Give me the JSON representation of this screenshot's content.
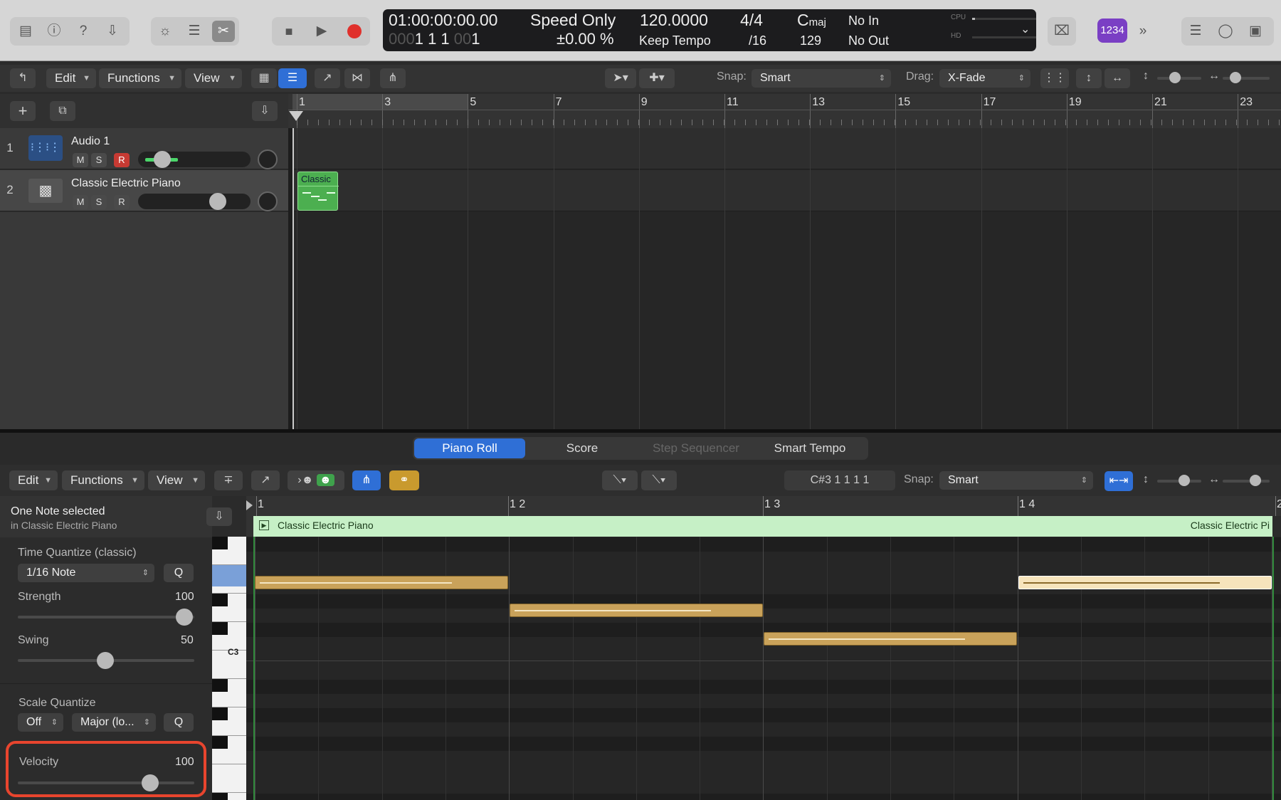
{
  "control_bar": {
    "lcd": {
      "timecode": "01:00:00:00.00",
      "bars_dim": "000",
      "bars_bright": "1  1  1",
      "ticks_dim": "00",
      "ticks_bright": "1",
      "speed_mode": "Speed Only",
      "speed_pct": "±0.00 %",
      "tempo": "120.0000",
      "tempo_mode": "Keep Tempo",
      "time_sig": "4/4",
      "division": "/16",
      "key_root": "C",
      "key_mode": "maj",
      "key_value": "129",
      "midi_in": "No In",
      "midi_out": "No Out",
      "cpu_label": "CPU",
      "hd_label": "HD"
    },
    "counter_badge": "1234"
  },
  "tracks_toolbar": {
    "edit": "Edit",
    "functions": "Functions",
    "view": "View",
    "snap_label": "Snap:",
    "snap_value": "Smart",
    "drag_label": "Drag:",
    "drag_value": "X-Fade"
  },
  "ruler": {
    "bars": [
      "1",
      "3",
      "5",
      "7",
      "9",
      "11",
      "13",
      "15",
      "17",
      "19",
      "21",
      "23"
    ]
  },
  "tracks": [
    {
      "number": "1",
      "name": "Audio 1",
      "m": "M",
      "s": "S",
      "r": "R"
    },
    {
      "number": "2",
      "name": "Classic Electric Piano",
      "m": "M",
      "s": "S",
      "r": "R"
    }
  ],
  "region": {
    "label": "Classic"
  },
  "editor_tabs": {
    "piano_roll": "Piano Roll",
    "score": "Score",
    "step_sequencer": "Step Sequencer",
    "smart_tempo": "Smart Tempo"
  },
  "piano_toolbar": {
    "edit": "Edit",
    "functions": "Functions",
    "view": "View",
    "position": "C#3  1 1 1 1",
    "snap_label": "Snap:",
    "snap_value": "Smart"
  },
  "inspector": {
    "selection_title": "One Note selected",
    "selection_sub": "in Classic Electric Piano",
    "time_quantize_label": "Time Quantize (classic)",
    "time_quantize_value": "1/16 Note",
    "q": "Q",
    "strength_label": "Strength",
    "strength_value": "100",
    "swing_label": "Swing",
    "swing_value": "50",
    "scale_quantize_label": "Scale Quantize",
    "scale_off": "Off",
    "scale_mode": "Major (lo...",
    "velocity_label": "Velocity",
    "velocity_value": "100"
  },
  "piano_roll": {
    "bars": [
      "1",
      "1 2",
      "1 3",
      "1 4",
      "2"
    ],
    "region_name_left": "Classic Electric Piano",
    "region_name_right": "Classic Electric Pi",
    "key_label": "C3"
  },
  "colors": {
    "accent_blue": "#2f6fd6",
    "record_red": "#e0312c",
    "region_green": "#4caf50",
    "note_gold": "#c9a25a",
    "highlight_red": "#e8452e",
    "purple_badge": "#7a3fc4"
  }
}
